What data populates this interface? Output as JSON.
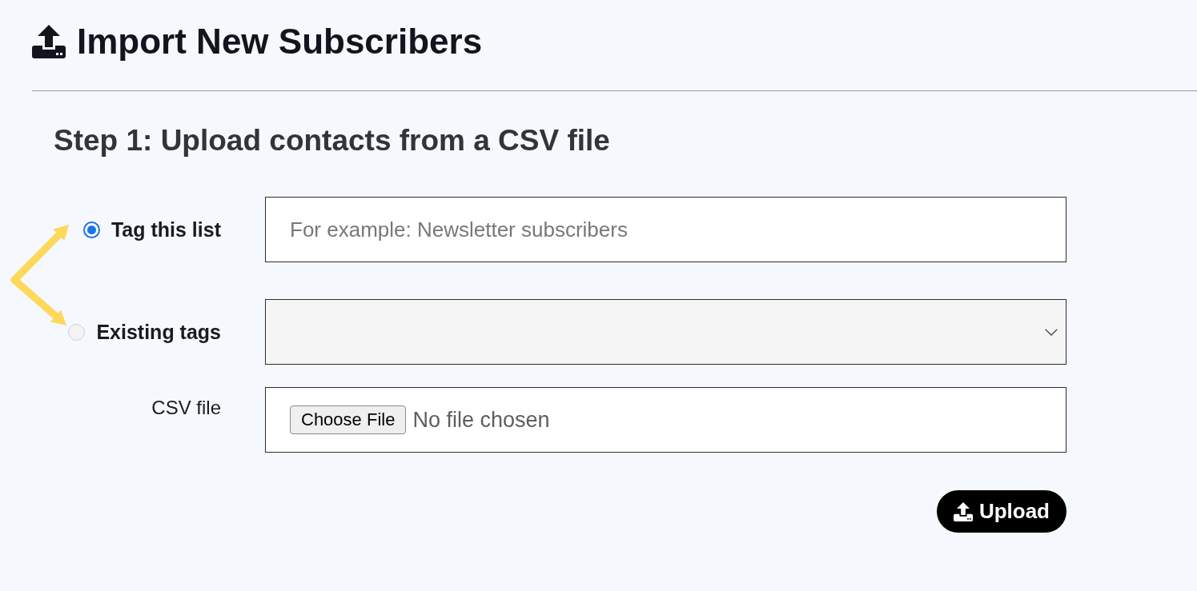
{
  "header": {
    "title": "Import New Subscribers"
  },
  "step": {
    "heading": "Step 1: Upload contacts from a CSV file"
  },
  "form": {
    "rows": [
      {
        "kind": "radio-text",
        "label": "Tag this list",
        "selected": true,
        "placeholder": "For example: Newsletter subscribers"
      },
      {
        "kind": "radio-select",
        "label": "Existing tags",
        "selected": false
      },
      {
        "kind": "file",
        "label": "CSV file",
        "button": "Choose File",
        "status": "No file chosen"
      }
    ]
  },
  "upload_button": {
    "label": "Upload"
  }
}
